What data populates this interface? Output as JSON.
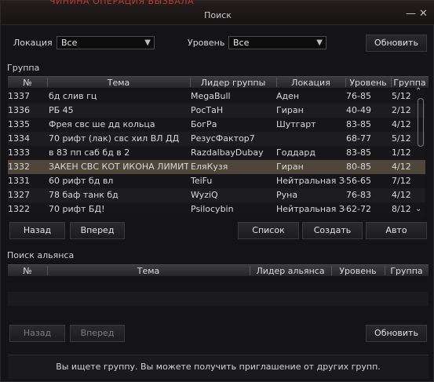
{
  "window": {
    "title": "Поиск",
    "top_fragment": "ЧИНИНА ОПЕРАЦИЯ ВЫЗВАЛА",
    "minimize_glyph": "—",
    "close_glyph": "✕"
  },
  "filters": {
    "location_label": "Локация",
    "location_value": "Все",
    "level_label": "Уровень",
    "level_value": "Все",
    "refresh_label": "Обновить"
  },
  "group": {
    "section_label": "Группа",
    "columns": [
      "№",
      "Тема",
      "Лидер группы",
      "Локация",
      "Уровень",
      "Группа"
    ],
    "rows": [
      {
        "num": "1337",
        "topic": "бд слив гц",
        "leader": "MegaBull",
        "location": "Аден",
        "level": "76-85",
        "group": "5/12"
      },
      {
        "num": "1336",
        "topic": "РБ 45",
        "leader": "РосТаН",
        "location": "Гиран",
        "level": "40-49",
        "group": "2/12"
      },
      {
        "num": "1335",
        "topic": "Фрея свс   ше дд кольца",
        "leader": "БогРа",
        "location": "Шутгарт",
        "level": "83-85",
        "group": "4/12"
      },
      {
        "num": "1334",
        "topic": "70 рифт (лак) свс хил ВЛ ДД",
        "leader": "РезусФактор7",
        "location": "",
        "level": "68-77",
        "group": "5/12"
      },
      {
        "num": "1333",
        "topic": "в 83 пп саб бд в 2",
        "leader": "RazdalbayDubay",
        "location": "Годдард",
        "level": "83-85",
        "group": "1/12"
      },
      {
        "num": "1332",
        "topic": "ЗАКЕН СВС КОТ ИКОНА ЛИМИТ",
        "leader": "ЕляКузя",
        "location": "Гиран",
        "level": "80-85",
        "group": "4/12"
      },
      {
        "num": "1331",
        "topic": "60 рифт бд вл",
        "leader": "TeiFu",
        "location": "Нейтральная Зона",
        "level": "56-65",
        "group": "7/12"
      },
      {
        "num": "1327",
        "topic": "78 баф танк бд",
        "leader": "WyziQ",
        "location": "Руна",
        "level": "76-83",
        "group": "4/12"
      },
      {
        "num": "1322",
        "topic": "70 рифт БД!",
        "leader": "Psilocybin",
        "location": "Нейтральная Зона",
        "level": "62-72",
        "group": "8/12"
      }
    ],
    "selected_index": 5,
    "buttons": {
      "back": "Назад",
      "forward": "Вперед",
      "list": "Список",
      "create": "Создать",
      "auto": "Авто"
    }
  },
  "alliance": {
    "section_label": "Поиск альянса",
    "columns": [
      "№",
      "Тема",
      "Лидер альянса",
      "Уровень",
      "Группа"
    ],
    "buttons": {
      "back": "Назад",
      "forward": "Вперед",
      "refresh": "Обновить"
    }
  },
  "status": {
    "text": "Вы ищете группу. Вы можете получить приглашение от других групп."
  },
  "colors": {
    "selected_row": "#4e453b",
    "header": "#2f2f31",
    "accent_red": "#c43b2b"
  }
}
